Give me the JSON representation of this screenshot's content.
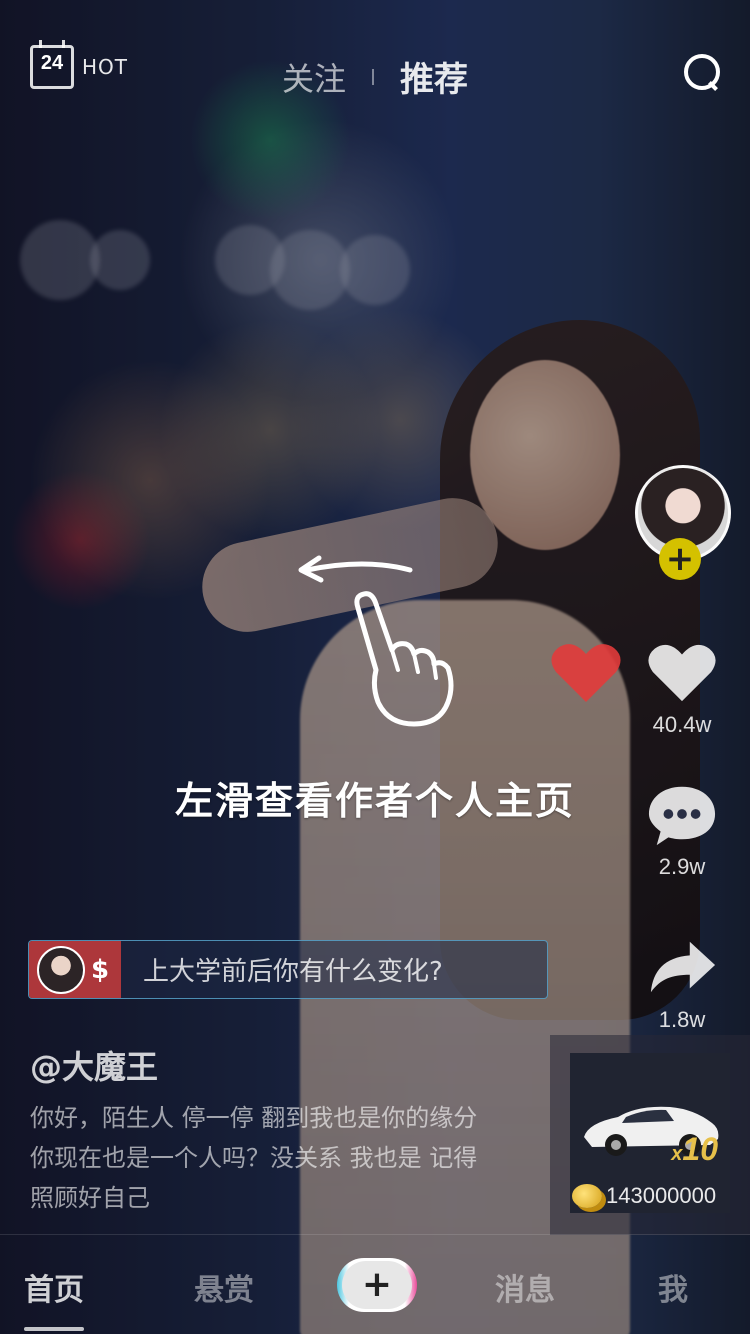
{
  "top_bar": {
    "calendar_number": "24",
    "hot_label": "HOT",
    "tabs": [
      {
        "label": "关注",
        "active": false
      },
      {
        "label": "推荐",
        "active": true
      }
    ],
    "search_icon": "search-icon"
  },
  "swipe_hint": {
    "text": "左滑查看作者个人主页",
    "icons": [
      "left-arrow-icon",
      "hand-pointer-icon"
    ]
  },
  "right_rail": {
    "follow_icon": "plus-icon",
    "like_count": "40.4w",
    "comment_count": "2.9w",
    "share_count": "1.8w"
  },
  "gift": {
    "multiplier_prefix": "x",
    "multiplier_value": "10",
    "coin_count": "143000000",
    "car_icon": "sports-car-icon",
    "coin_icon": "coin-icon"
  },
  "bounty": {
    "symbol": "$",
    "question": "上大学前后你有什么变化?"
  },
  "post": {
    "author": "@大魔王",
    "caption_lines": [
      "你好，陌生人 停一停 翻到我也是你的缘分",
      "你现在也是一个人吗？没关系 我也是 记得",
      "照顾好自己"
    ]
  },
  "bottom_nav": {
    "items": [
      {
        "label": "首页",
        "active": true
      },
      {
        "label": "悬赏",
        "active": false
      },
      {
        "label": "消息",
        "active": false
      },
      {
        "label": "我",
        "active": false
      }
    ],
    "create_label": "+"
  },
  "colors": {
    "follow_plus": "#d4c100",
    "like_heart_red": "#e23b3b",
    "bounty_accent": "#c83c3c",
    "coin_gold": "#e6c04a"
  }
}
